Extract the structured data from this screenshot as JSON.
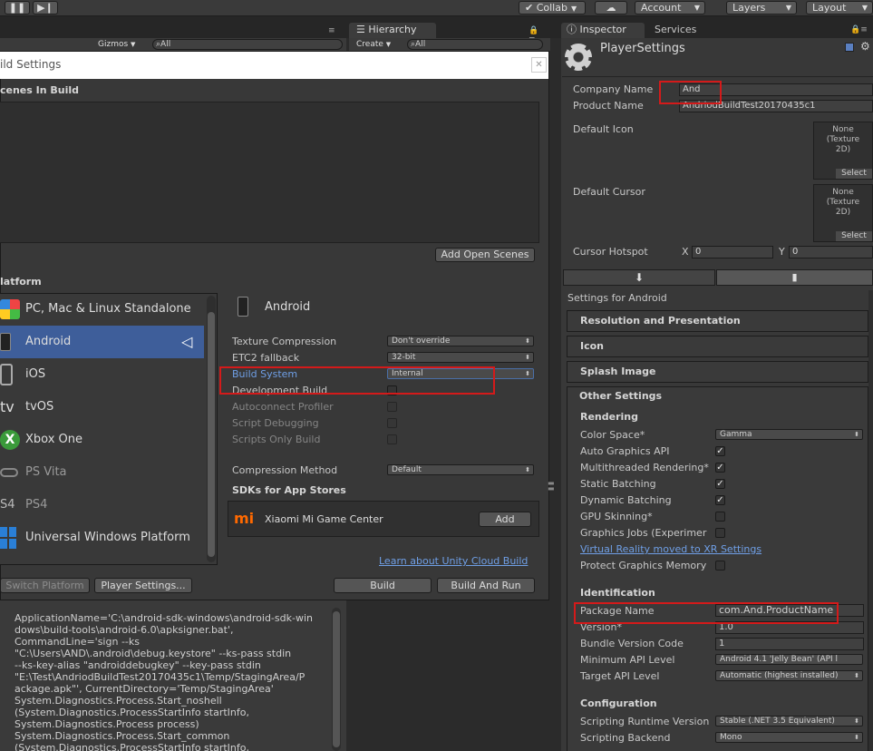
{
  "toolbar": {
    "collab": "Collab",
    "account": "Account",
    "layers": "Layers",
    "layout": "Layout"
  },
  "scene_bar": {
    "gizmos": "Gizmos",
    "search_all": "All"
  },
  "hierarchy": {
    "tab": "Hierarchy",
    "create": "Create",
    "search_all": "All"
  },
  "inspector_tabs": {
    "inspector": "Inspector",
    "services": "Services"
  },
  "build_settings": {
    "title": "ild Settings",
    "scenes_in_build": "cenes In Build",
    "add_open_scenes": "Add Open Scenes",
    "platform_header": "latform",
    "platforms": [
      {
        "name": "PC, Mac & Linux Standalone",
        "icon": "windows-logo-icon"
      },
      {
        "name": "Android",
        "icon": "android-icon",
        "selected": true
      },
      {
        "name": "iOS",
        "icon": "ios-icon"
      },
      {
        "name": "tvOS",
        "icon": "tvos-icon",
        "icon_text": "tv"
      },
      {
        "name": "Xbox One",
        "icon": "xbox-icon"
      },
      {
        "name": "PS Vita",
        "icon": "ps-vita-icon"
      },
      {
        "name": "PS4",
        "icon": "ps4-icon",
        "icon_text": "S4"
      },
      {
        "name": "Universal Windows Platform",
        "icon": "windows-icon"
      }
    ],
    "selected_platform": "Android",
    "settings": {
      "texture_compression_label": "Texture Compression",
      "texture_compression_value": "Don't override",
      "etc2_fallback_label": "ETC2 fallback",
      "etc2_fallback_value": "32-bit",
      "build_system_label": "Build System",
      "build_system_value": "Internal",
      "development_build_label": "Development Build",
      "autoconnect_profiler_label": "Autoconnect Profiler",
      "script_debugging_label": "Script Debugging",
      "scripts_only_build_label": "Scripts Only Build",
      "compression_method_label": "Compression Method",
      "compression_method_value": "Default",
      "sdks_header": "SDKs for App Stores",
      "sdk_name": "Xiaomi Mi Game Center",
      "sdk_add": "Add",
      "cloud_build_link": "Learn about Unity Cloud Build"
    },
    "switch_platform": "Switch Platform",
    "player_settings": "Player Settings...",
    "build": "Build",
    "build_and_run": "Build And Run"
  },
  "console": {
    "lines": [
      "ApplicationName='C:\\android-sdk-windows\\android-sdk-win",
      "dows\\build-tools\\android-6.0\\apksigner.bat',",
      "CommandLine='sign --ks",
      "\"C:\\Users\\AND\\.android\\debug.keystore\" --ks-pass stdin",
      "--ks-key-alias \"androiddebugkey\" --key-pass stdin",
      "\"E:\\Test\\AndriodBuildTest20170435c1\\Temp/StagingArea/P",
      "ackage.apk\"', CurrentDirectory='Temp/StagingArea'",
      "System.Diagnostics.Process.Start_noshell",
      "(System.Diagnostics.ProcessStartInfo startInfo,",
      "System.Diagnostics.Process process)",
      "System.Diagnostics.Process.Start_common",
      "(System.Diagnostics.ProcessStartInfo startInfo,"
    ]
  },
  "inspector": {
    "title": "PlayerSettings",
    "company_name_label": "Company Name",
    "company_name_value": "And",
    "product_name_label": "Product Name",
    "product_name_value": "AndriodBuildTest20170435c1",
    "default_icon_label": "Default Icon",
    "default_cursor_label": "Default Cursor",
    "none_texture": "None (Texture 2D)",
    "select": "Select",
    "cursor_hotspot_label": "Cursor Hotspot",
    "hotspot_x_label": "X",
    "hotspot_x": "0",
    "hotspot_y_label": "Y",
    "hotspot_y": "0",
    "settings_for": "Settings for Android",
    "sections": {
      "resolution": "Resolution and Presentation",
      "icon": "Icon",
      "splash": "Splash Image",
      "other": "Other Settings"
    },
    "rendering_header": "Rendering",
    "color_space_label": "Color Space*",
    "color_space_value": "Gamma",
    "auto_graphics_label": "Auto Graphics API",
    "multithreaded_label": "Multithreaded Rendering*",
    "static_batching_label": "Static Batching",
    "dynamic_batching_label": "Dynamic Batching",
    "gpu_skinning_label": "GPU Skinning*",
    "graphics_jobs_label": "Graphics Jobs (Experimer",
    "vr_link": "Virtual Reality moved to XR Settings",
    "protect_graphics_label": "Protect Graphics Memory",
    "identification_header": "Identification",
    "package_name_label": "Package Name",
    "package_name_value": "com.And.ProductName",
    "version_label": "Version*",
    "version_value": "1.0",
    "bundle_code_label": "Bundle Version Code",
    "bundle_code_value": "1",
    "min_api_label": "Minimum API Level",
    "min_api_value": "Android 4.1 'Jelly Bean' (API l",
    "target_api_label": "Target API Level",
    "target_api_value": "Automatic (highest installed)",
    "configuration_header": "Configuration",
    "scripting_runtime_label": "Scripting Runtime Version",
    "scripting_runtime_value": "Stable (.NET 3.5 Equivalent)",
    "scripting_backend_label": "Scripting Backend",
    "scripting_backend_value": "Mono"
  },
  "colors": {
    "highlight_red": "#d41a1a",
    "selected_row": "#3e5e9a",
    "link_blue": "#6f9fe6"
  }
}
